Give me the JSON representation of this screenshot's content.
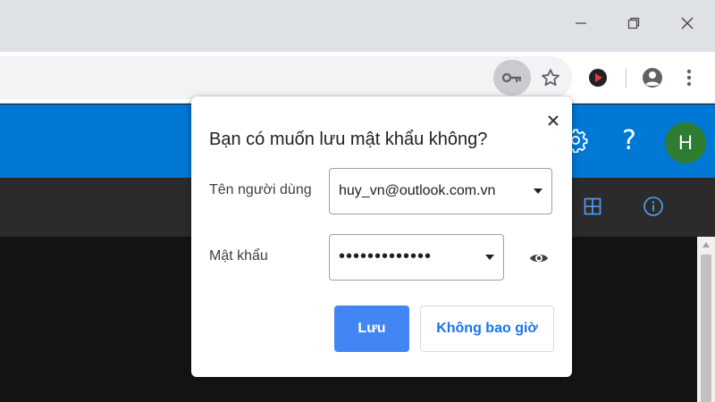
{
  "window": {
    "icons": {
      "minimize": "minimize-icon",
      "maximize": "restore-icon",
      "close": "close-icon"
    }
  },
  "toolbar": {
    "icons": [
      "key-icon",
      "star-icon",
      "extension-icon",
      "profile-icon",
      "kebab-menu-icon"
    ]
  },
  "app_header": {
    "help_label": "?",
    "avatar_initial": "H",
    "avatar_color": "#2e7d32",
    "accent_color": "#0078d4"
  },
  "dialog": {
    "title": "Bạn có muốn lưu mật khẩu không?",
    "username_label": "Tên người dùng",
    "username_value": "huy_vn@outlook.com.vn",
    "password_label": "Mật khẩu",
    "password_value": "•••••••••••••",
    "save_label": "Lưu",
    "never_label": "Không bao giờ",
    "save_color": "#4285f4"
  }
}
